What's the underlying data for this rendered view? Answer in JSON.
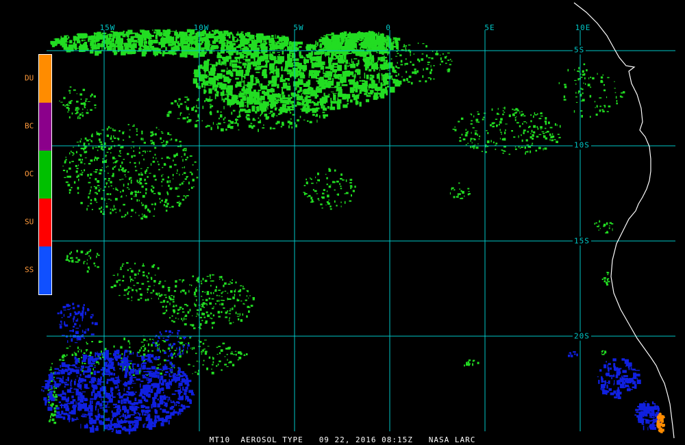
{
  "map": {
    "product": "MT10",
    "title": "AEROSOL TYPE",
    "date": "09 22, 2016",
    "time": "08:15Z",
    "source": "NASA LARC",
    "longitude_labels": [
      "15W",
      "10W",
      "5W",
      "0",
      "5E",
      "10E"
    ],
    "latitude_labels": [
      "5S",
      "10S",
      "15S",
      "20S"
    ],
    "grid_color": "#00c8c8",
    "coastline_color": "#ffffff",
    "background": "#000000"
  },
  "legend": {
    "items": [
      {
        "code": "DU",
        "color": "#ff8c00"
      },
      {
        "code": "BC",
        "color": "#8b008b"
      },
      {
        "code": "OC",
        "color": "#00c000"
      },
      {
        "code": "SU",
        "color": "#ff0000"
      },
      {
        "code": "SS",
        "color": "#1050ff"
      }
    ]
  }
}
